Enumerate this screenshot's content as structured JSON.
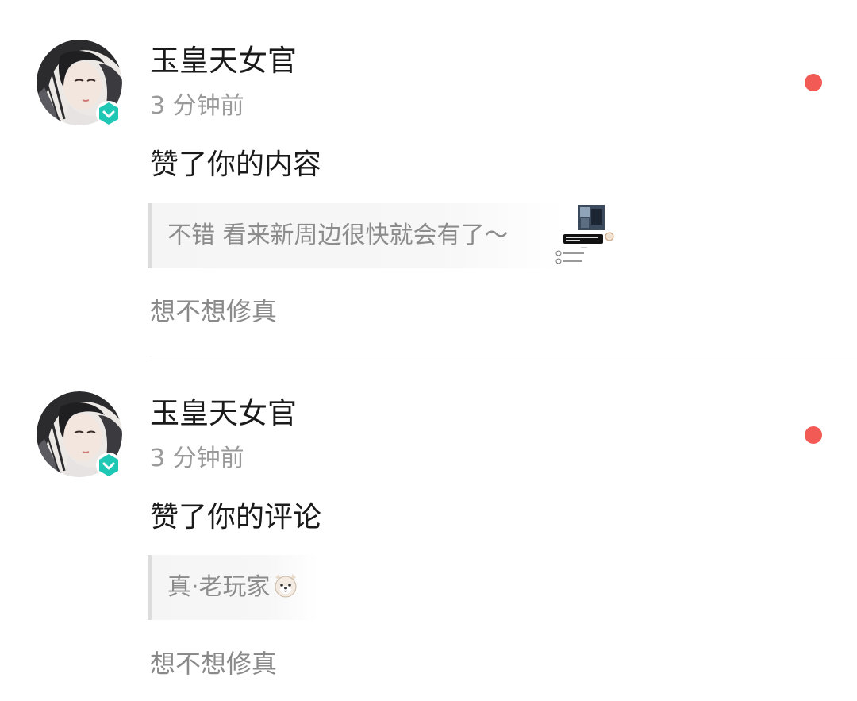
{
  "notifications": [
    {
      "user_name": "玉皇天女官",
      "time": "3 分钟前",
      "action": "赞了你的内容",
      "quote": "不错 看来新周边很快就会有了～",
      "source": "想不想修真",
      "unread": true,
      "has_thumbnail": true
    },
    {
      "user_name": "玉皇天女官",
      "time": "3 分钟前",
      "action": "赞了你的评论",
      "quote": "真·老玩家",
      "source": "想不想修真",
      "unread": true,
      "has_thumbnail": false
    }
  ],
  "colors": {
    "unread_dot": "#f25b55",
    "verify_badge": "#1ec8b5",
    "primary_text": "#1a1a1a",
    "secondary_text": "#9a9a9a",
    "quote_bg": "#f5f5f5",
    "quote_bar": "#dcdcdc"
  },
  "icons": {
    "verified_badge": "verified-check-icon",
    "quote_emoji": "dog-face-emoji-icon"
  }
}
